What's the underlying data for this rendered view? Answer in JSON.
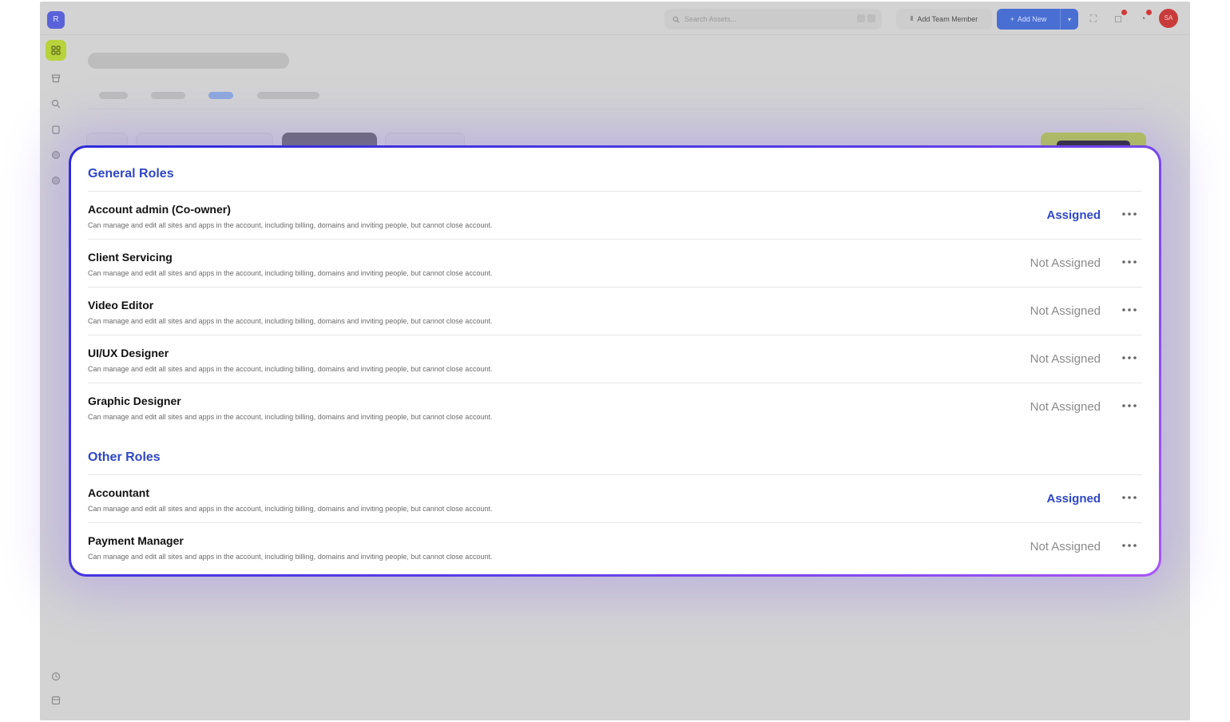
{
  "app": {
    "logo_letter": "R",
    "search": {
      "placeholder": "Search Assets..."
    },
    "add_team_member_label": "Add Team Member",
    "add_new_label": "Add New",
    "avatar_initials": "SA"
  },
  "colors": {
    "accent": "#2f47c4",
    "card_border_start": "#2e2bd8",
    "card_border_end": "#a855f7",
    "sidebar_active": "#b7d23a"
  },
  "roles": {
    "general": {
      "title": "General Roles",
      "items": [
        {
          "name": "Account admin (Co-owner)",
          "description": "Can manage and edit all sites and apps in the account, including billing, domains and inviting people, but cannot close account.",
          "status": "Assigned"
        },
        {
          "name": "Client Servicing",
          "description": "Can manage and edit all sites and apps in the account, including billing, domains and inviting people, but cannot close account.",
          "status": "Not Assigned"
        },
        {
          "name": "Video Editor",
          "description": "Can manage and edit all sites and apps in the account, including billing, domains and inviting people, but cannot close account.",
          "status": "Not Assigned"
        },
        {
          "name": "UI/UX Designer",
          "description": "Can manage and edit all sites and apps in the account, including billing, domains and inviting people, but cannot close account.",
          "status": "Not Assigned"
        },
        {
          "name": "Graphic Designer",
          "description": "Can manage and edit all sites and apps in the account, including billing, domains and inviting people, but cannot close account.",
          "status": "Not Assigned"
        }
      ]
    },
    "other": {
      "title": "Other Roles",
      "items": [
        {
          "name": "Accountant",
          "description": "Can manage and edit all sites and apps in the account, including billing, domains and inviting people, but cannot close account.",
          "status": "Assigned"
        },
        {
          "name": "Payment Manager",
          "description": "Can manage and edit all sites and apps in the account, including billing, domains and inviting people, but cannot close account.",
          "status": "Not Assigned"
        }
      ]
    }
  },
  "more_icon": "more-horizontal-icon"
}
